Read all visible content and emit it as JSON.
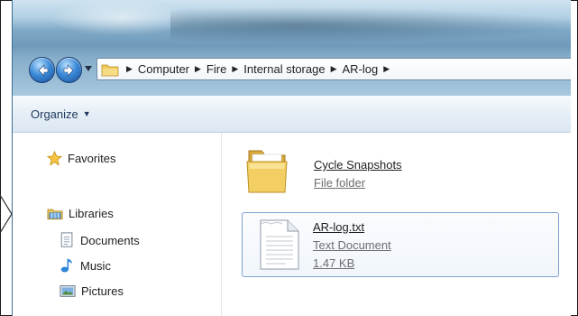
{
  "address_bar": {
    "crumbs": [
      "Computer",
      "Fire",
      "Internal storage",
      "AR-log"
    ]
  },
  "toolbar": {
    "organize_label": "Organize",
    "organize_caret": "▼"
  },
  "navigation_pane": {
    "favorites_label": "Favorites",
    "libraries_label": "Libraries",
    "library_items": [
      "Documents",
      "Music",
      "Pictures"
    ]
  },
  "content": {
    "items": [
      {
        "name": "Cycle Snapshots",
        "type": "File folder",
        "icon": "folder-icon"
      },
      {
        "name": "AR-log.txt",
        "type": "Text Document",
        "size": "1.47 KB",
        "icon": "text-document-icon"
      }
    ]
  },
  "icons": {
    "back": "back-arrow-icon",
    "forward": "forward-arrow-icon",
    "history": "chevron-down-icon",
    "breadcrumb_separator": "chevron-right-icon",
    "favorites": "star-icon",
    "libraries": "libraries-icon",
    "documents": "documents-icon",
    "music": "music-note-icon",
    "pictures": "pictures-icon"
  },
  "colors": {
    "accent_blue": "#3b8bd8",
    "selection_border": "#7da2ce",
    "folder_yellow": "#f0c95a",
    "link_text": "#1e395b"
  }
}
